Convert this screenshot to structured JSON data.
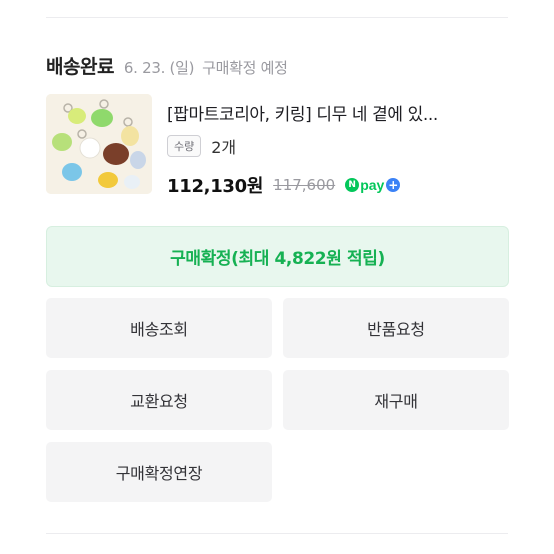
{
  "order": {
    "status": "배송완료",
    "date": "6. 23. (일)",
    "note": "구매확정 예정"
  },
  "product": {
    "name": "[팝마트코리아, 키링] 디무 네 곁에 있...",
    "qty_label": "수량",
    "qty": "2개",
    "price": "112,130원",
    "original_price": "117,600",
    "npay_n": "N",
    "npay_text": "pay",
    "npay_plus": "+"
  },
  "actions": {
    "confirm": "구매확정(최대 4,822원 적립)",
    "track": "배송조회",
    "return": "반품요청",
    "exchange": "교환요청",
    "rebuy": "재구매",
    "extend": "구매확정연장"
  },
  "colors": {
    "accent_green": "#16b153",
    "confirm_bg": "#e8f7ee",
    "button_bg": "#f4f4f5"
  }
}
